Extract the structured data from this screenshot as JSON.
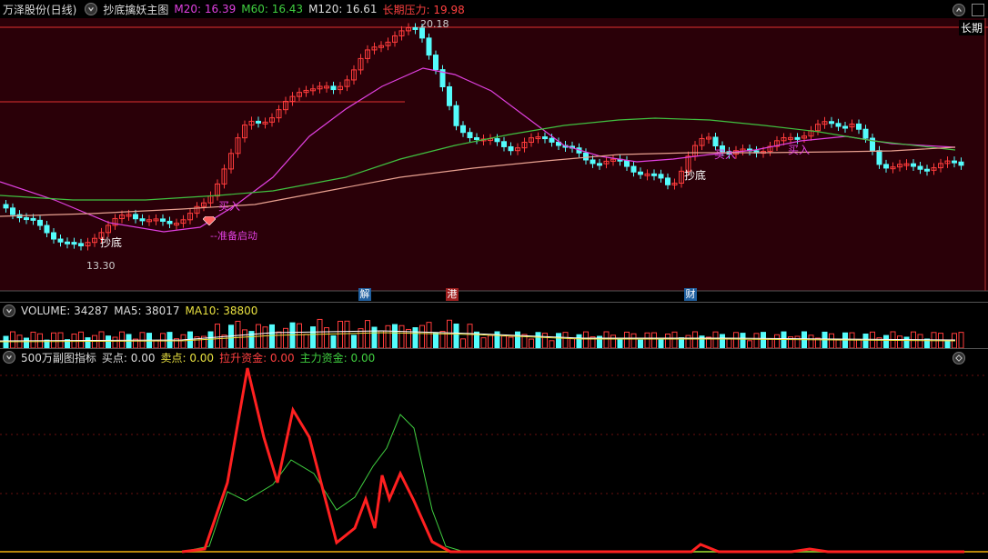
{
  "header": {
    "stock": "万泽股份(日线)",
    "indicator": "抄底擒妖主图",
    "m20_label": "M20: 16.39",
    "m60_label": "M60: 16.43",
    "m120_label": "M120: 16.61",
    "pressure_label": "长期压力: 19.98",
    "right_tag": "长期"
  },
  "annotations": {
    "high": "20.18",
    "low": "13.30",
    "buy1": "买入",
    "buy2": "买入",
    "buy3": "买入",
    "bottom1": "抄底",
    "bottom2": "抄底",
    "ready": "--准备启动"
  },
  "markers": {
    "m1": "解",
    "m2": "港",
    "m3": "财"
  },
  "volume_header": {
    "volume": "VOLUME: 34287",
    "ma5": "MA5: 38017",
    "ma10": "MA10: 38800"
  },
  "sub_header": {
    "name": "500万副图指标",
    "buy": "买点: 0.00",
    "sell": "卖点: 0.00",
    "lift": "拉升资金: 0.00",
    "main": "主力资金: 0.00"
  },
  "colors": {
    "up": "#ff3c3c",
    "down": "#54fcfc",
    "ma20": "#e040e0",
    "ma60": "#40c040",
    "ma120": "#e8a090",
    "pressure": "#e03030",
    "bg_main": "#2a0008"
  }
}
